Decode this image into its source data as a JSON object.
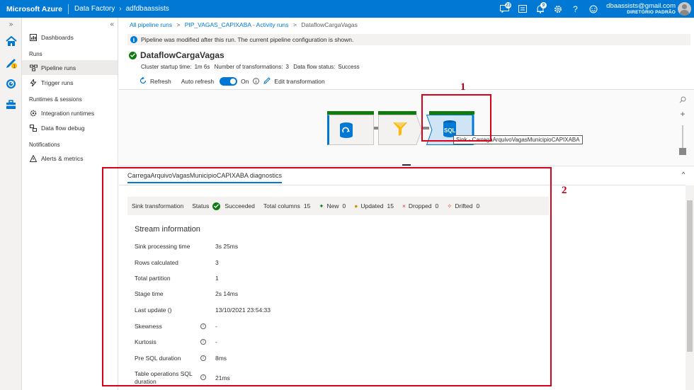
{
  "topbar": {
    "brand": "Microsoft Azure",
    "service": "Data Factory",
    "factory": "adfdbaassists",
    "notifications": [
      {
        "icon": "feedback-icon",
        "badge": "23"
      },
      {
        "icon": "directory-icon",
        "badge": ""
      },
      {
        "icon": "bell-icon",
        "badge": "9"
      },
      {
        "icon": "gear-icon",
        "badge": ""
      },
      {
        "icon": "help-icon",
        "badge": ""
      },
      {
        "icon": "smiley-icon",
        "badge": ""
      }
    ],
    "user_email": "dbaassists@gmail.com",
    "user_directory": "DIRETÓRIO PADRÃO"
  },
  "rail": {
    "expand": "»"
  },
  "sidebar": {
    "collapse": "«",
    "dashboards": "Dashboards",
    "runs_header": "Runs",
    "pipeline_runs": "Pipeline runs",
    "trigger_runs": "Trigger runs",
    "runtimes_header": "Runtimes & sessions",
    "integration_runtimes": "Integration runtimes",
    "data_flow_debug": "Data flow debug",
    "notifications_header": "Notifications",
    "alerts_metrics": "Alerts & metrics"
  },
  "breadcrumb": {
    "all_runs": "All pipeline runs",
    "activity_runs": "PIP_VAGAS_CAPIXABA - Activity runs",
    "current": "DataflowCargaVagas",
    "sep": ">"
  },
  "info_bar": {
    "icon_glyph": "i",
    "text": "Pipeline was modified after this run. The current pipeline configuration is shown."
  },
  "run": {
    "title": "DataflowCargaVagas",
    "cluster_label": "Cluster startup time:",
    "cluster_value": "1m 6s",
    "transforms_label": "Number of transformations:",
    "transforms_value": "3",
    "status_label": "Data flow status:",
    "status_value": "Success"
  },
  "toolbar": {
    "refresh": "Refresh",
    "auto_refresh": "Auto refresh",
    "toggle_state": "On",
    "edit": "Edit transformation"
  },
  "canvas": {
    "sink_label": "SQL",
    "tooltip": "Sink - CarregaArquivoVagasMunicipioCAPIXABA",
    "zoom_in": "+"
  },
  "diagnostics": {
    "tab": "CarregaArquivoVagasMunicipioCAPIXABA diagnostics",
    "collapse": "^",
    "summary": {
      "sink_label": "Sink transformation",
      "status_label": "Status",
      "status_value": "Succeeded",
      "total_columns_label": "Total columns",
      "total_columns_value": "15",
      "new_label": "New",
      "new_value": "0",
      "updated_label": "Updated",
      "updated_value": "15",
      "dropped_label": "Dropped",
      "dropped_value": "0",
      "drifted_label": "Drifted",
      "drifted_value": "0"
    },
    "stream_title": "Stream information",
    "rows": [
      {
        "key": "Sink processing time",
        "value": "3s 25ms",
        "info": false
      },
      {
        "key": "Rows calculated",
        "value": "3",
        "info": false
      },
      {
        "key": "Total partition",
        "value": "1",
        "info": false
      },
      {
        "key": "Stage time",
        "value": "2s 14ms",
        "info": false
      },
      {
        "key": "Last update ()",
        "value": "13/10/2021 23:54:33",
        "info": false
      },
      {
        "key": "Skewness",
        "value": "-",
        "info": true
      },
      {
        "key": "Kurtosis",
        "value": "-",
        "info": true
      },
      {
        "key": "Pre SQL duration",
        "value": "8ms",
        "info": true
      },
      {
        "key": "Table operations SQL duration",
        "value": "21ms",
        "info": true
      }
    ]
  },
  "annotations": {
    "box1": "1",
    "box2": "2"
  },
  "colors": {
    "accent": "#0078d4",
    "success": "#107c10",
    "annotation": "#d8001b"
  }
}
